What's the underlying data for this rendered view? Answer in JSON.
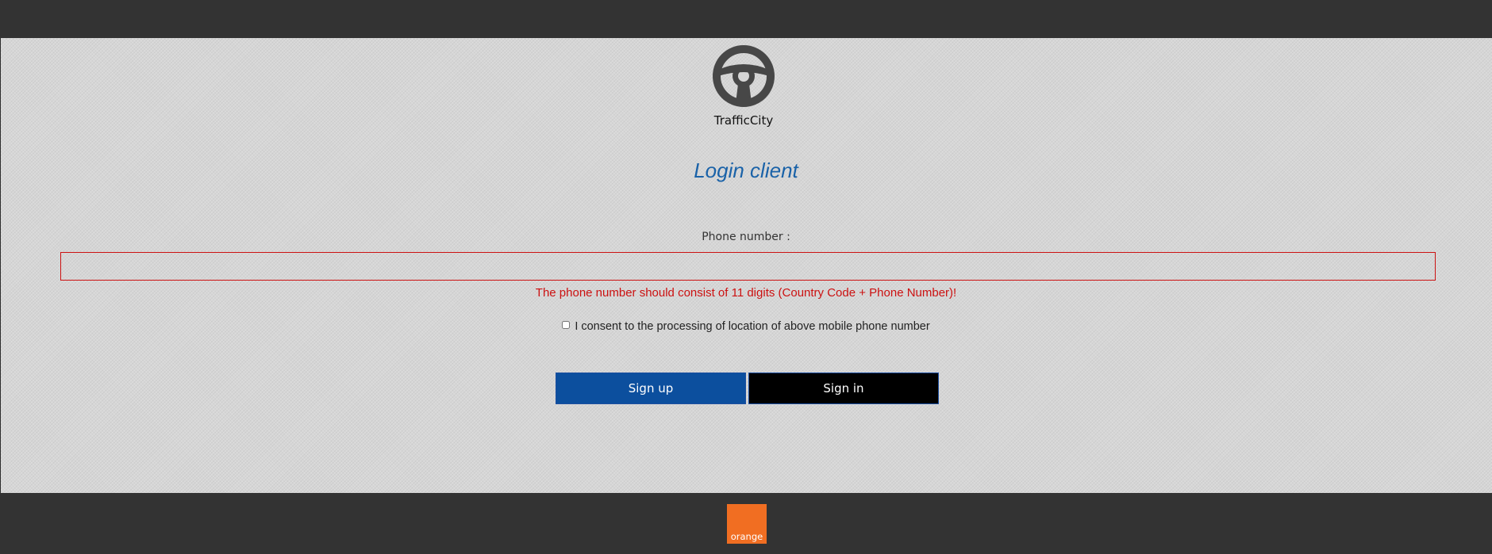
{
  "brand": {
    "name": "TrafficCity",
    "icon": "steering-wheel-icon"
  },
  "page": {
    "title": "Login client"
  },
  "form": {
    "phone_label": "Phone number :",
    "phone_value": "",
    "phone_placeholder": "",
    "error_message": "The phone number should consist of 11 digits (Country Code + Phone Number)!",
    "consent_label": "I consent to the processing of location of above mobile phone number",
    "consent_checked": false
  },
  "buttons": {
    "signup_label": "Sign up",
    "signin_label": "Sign in"
  },
  "footer": {
    "partner_logo_text": "orange",
    "partner_logo_color": "#f16e22"
  },
  "colors": {
    "header_bg": "#333333",
    "title": "#1a62a8",
    "error": "#cc1111",
    "signup_bg": "#0c4f9e",
    "signin_bg": "#000000"
  }
}
